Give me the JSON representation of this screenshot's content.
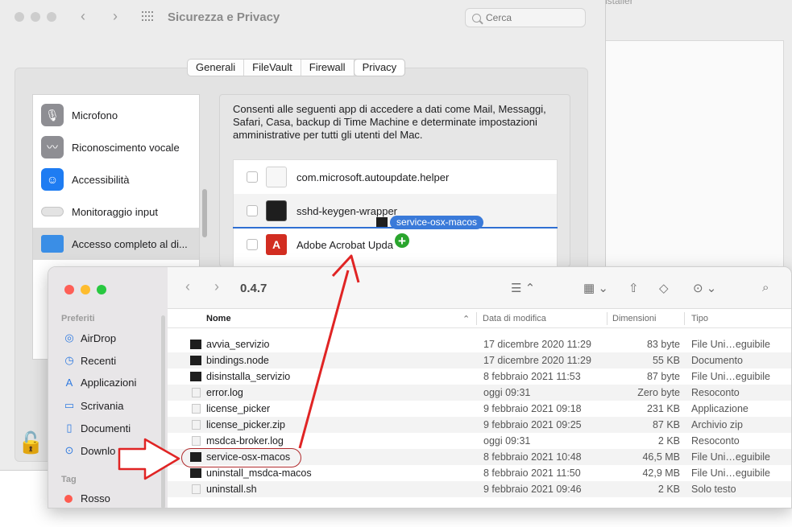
{
  "background_window": {
    "title": "nstaller"
  },
  "prefs": {
    "title": "Sicurezza e Privacy",
    "search_placeholder": "Cerca",
    "tabs": [
      "Generali",
      "FileVault",
      "Firewall",
      "Privacy"
    ],
    "active_tab": "Privacy",
    "categories": [
      {
        "label": "Microfono",
        "icon": "microphone-icon",
        "color": "#8e8e93"
      },
      {
        "label": "Riconoscimento vocale",
        "icon": "waveform-icon",
        "color": "#8e8e93"
      },
      {
        "label": "Accessibilità",
        "icon": "accessibility-icon",
        "color": "#1e7cf2"
      },
      {
        "label": "Monitoraggio input",
        "icon": "keyboard-icon",
        "color": "#e3e3e3"
      },
      {
        "label": "Accesso completo al di...",
        "icon": "folder-icon",
        "color": "#3a8ee6"
      }
    ],
    "description": "Consenti alle seguenti app di accedere a dati come Mail, Messaggi, Safari, Casa, backup di Time Machine e determinate impostazioni amministrative per tutti gli utenti del Mac.",
    "apps": [
      {
        "label": "com.microsoft.autoupdate.helper",
        "icon": "document-icon"
      },
      {
        "label": "sshd-keygen-wrapper",
        "icon": "terminal-icon"
      },
      {
        "label": "Adobe Acrobat Upda",
        "icon": "acrobat-icon"
      }
    ],
    "drag_label": "service-osx-macos",
    "plus_symbol": "+"
  },
  "finder": {
    "path": "0.4.7",
    "sidebar": {
      "favorites_label": "Preferiti",
      "items": [
        {
          "label": "AirDrop",
          "icon": "airdrop-icon",
          "glyph": "◎"
        },
        {
          "label": "Recenti",
          "icon": "clock-icon",
          "glyph": "◷"
        },
        {
          "label": "Applicazioni",
          "icon": "apps-icon",
          "glyph": "A"
        },
        {
          "label": "Scrivania",
          "icon": "desktop-icon",
          "glyph": "▭"
        },
        {
          "label": "Documenti",
          "icon": "documents-icon",
          "glyph": "▯"
        },
        {
          "label": "Downlo",
          "icon": "download-icon",
          "glyph": "⊙"
        }
      ],
      "tags_label": "Tag",
      "tags": [
        {
          "label": "Rosso",
          "color": "#fe5b50"
        }
      ]
    },
    "columns": {
      "name": "Nome",
      "date": "Data di modifica",
      "size": "Dimensioni",
      "type": "Tipo"
    },
    "files": [
      {
        "name": "avvia_servizio",
        "date": "17 dicembre 2020 11:29",
        "size": "83 byte",
        "type": "File Uni…eguibile",
        "kind": "exe"
      },
      {
        "name": "bindings.node",
        "date": "17 dicembre 2020 11:29",
        "size": "55 KB",
        "type": "Documento",
        "kind": "exe"
      },
      {
        "name": "disinstalla_servizio",
        "date": "8 febbraio 2021 11:53",
        "size": "87 byte",
        "type": "File Uni…eguibile",
        "kind": "exe"
      },
      {
        "name": "error.log",
        "date": "oggi 09:31",
        "size": "Zero byte",
        "type": "Resoconto",
        "kind": "doc"
      },
      {
        "name": "license_picker",
        "date": "9 febbraio 2021 09:18",
        "size": "231 KB",
        "type": "Applicazione",
        "kind": "doc"
      },
      {
        "name": "license_picker.zip",
        "date": "9 febbraio 2021 09:25",
        "size": "87 KB",
        "type": "Archivio zip",
        "kind": "doc"
      },
      {
        "name": "msdca-broker.log",
        "date": "oggi 09:31",
        "size": "2 KB",
        "type": "Resoconto",
        "kind": "doc"
      },
      {
        "name": "service-osx-macos",
        "date": "8 febbraio 2021 10:48",
        "size": "46,5 MB",
        "type": "File Uni…eguibile",
        "kind": "exe"
      },
      {
        "name": "uninstall_msdca-macos",
        "date": "8 febbraio 2021 11:50",
        "size": "42,9 MB",
        "type": "File Uni…eguibile",
        "kind": "exe"
      },
      {
        "name": "uninstall.sh",
        "date": "9 febbraio 2021 09:46",
        "size": "2 KB",
        "type": "Solo testo",
        "kind": "doc"
      }
    ]
  },
  "annotation": {
    "arrow_color": "#e02424",
    "outline_color": "#b0292b"
  }
}
